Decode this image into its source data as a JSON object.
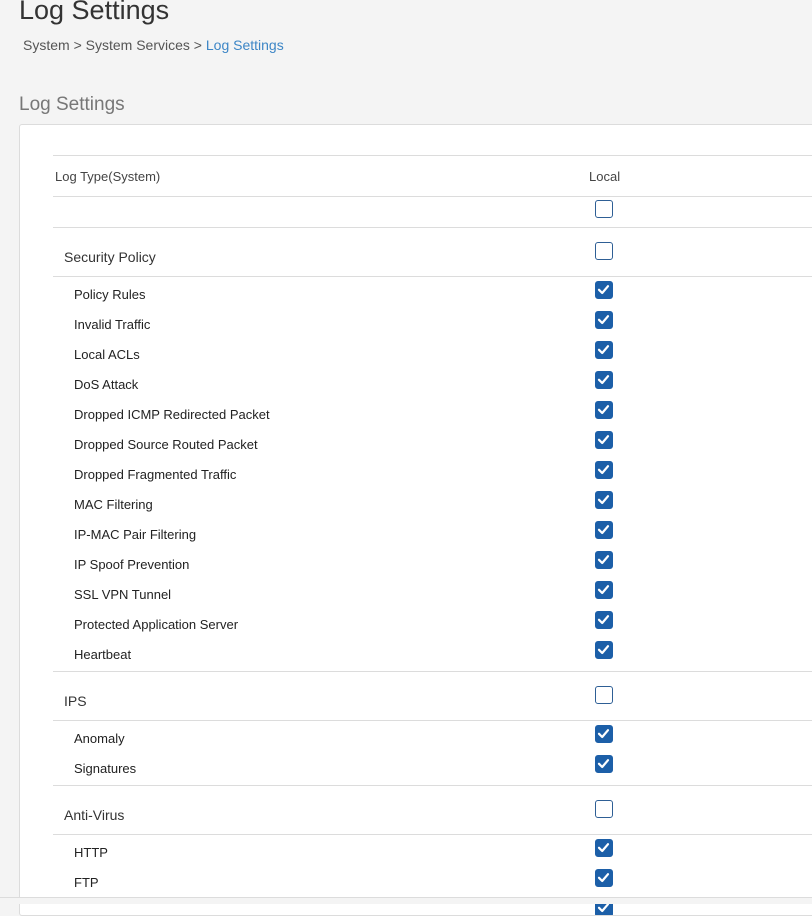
{
  "page": {
    "title": "Log Settings",
    "breadcrumb": {
      "item1": "System",
      "sep1": ">",
      "item2": "System Services",
      "sep2": ">",
      "current": "Log Settings"
    },
    "section_title": "Log Settings"
  },
  "table": {
    "col_type": "Log Type(System)",
    "col_local": "Local",
    "select_all_checked": false
  },
  "groups": [
    {
      "label": "Security Policy",
      "checked": false,
      "items": [
        {
          "label": "Policy Rules",
          "checked": true
        },
        {
          "label": "Invalid Traffic",
          "checked": true
        },
        {
          "label": "Local ACLs",
          "checked": true
        },
        {
          "label": "DoS Attack",
          "checked": true
        },
        {
          "label": "Dropped ICMP Redirected Packet",
          "checked": true
        },
        {
          "label": "Dropped Source Routed Packet",
          "checked": true
        },
        {
          "label": "Dropped Fragmented Traffic",
          "checked": true
        },
        {
          "label": "MAC Filtering",
          "checked": true
        },
        {
          "label": "IP-MAC Pair Filtering",
          "checked": true
        },
        {
          "label": "IP Spoof Prevention",
          "checked": true
        },
        {
          "label": "SSL VPN Tunnel",
          "checked": true
        },
        {
          "label": "Protected Application Server",
          "checked": true
        },
        {
          "label": "Heartbeat",
          "checked": true
        }
      ]
    },
    {
      "label": "IPS",
      "checked": false,
      "items": [
        {
          "label": "Anomaly",
          "checked": true
        },
        {
          "label": "Signatures",
          "checked": true
        }
      ]
    },
    {
      "label": "Anti-Virus",
      "checked": false,
      "items": [
        {
          "label": "HTTP",
          "checked": true
        },
        {
          "label": "FTP",
          "checked": true
        },
        {
          "label": "",
          "checked": true
        }
      ]
    }
  ],
  "colors": {
    "accent": "#1c5fa8",
    "breadcrumb_active": "#3d86c6"
  }
}
